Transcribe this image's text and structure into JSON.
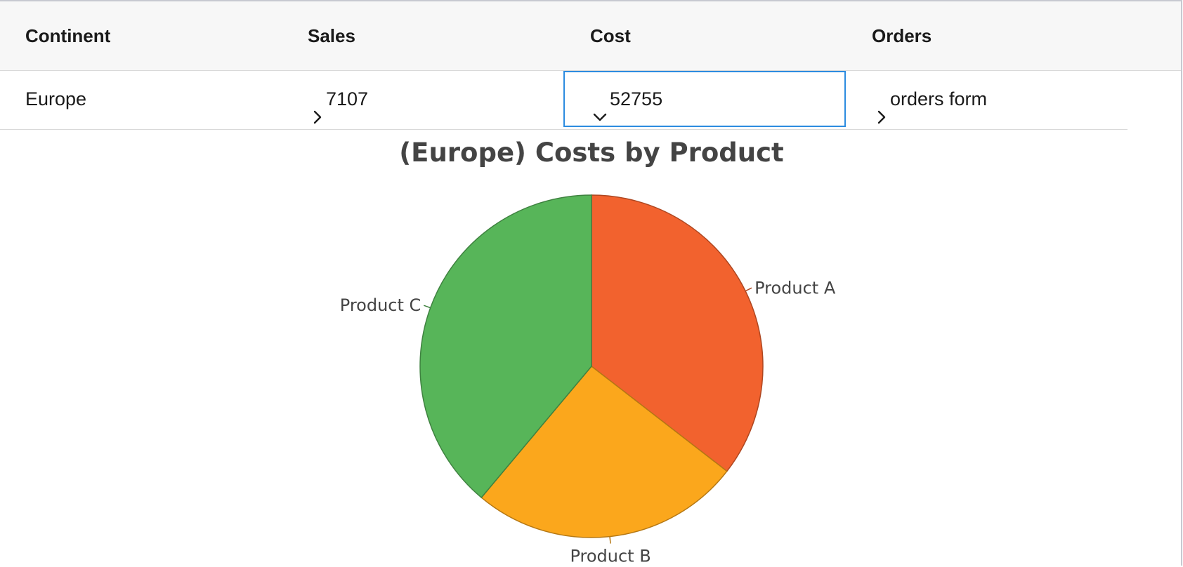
{
  "table": {
    "columns": [
      "Continent",
      "Sales",
      "Cost",
      "Orders"
    ],
    "row": {
      "continent": "Europe",
      "sales": "7107",
      "cost": "52755",
      "orders": "orders form"
    },
    "expanded_column": "Cost"
  },
  "icons": {
    "collapsed": "chevron-right-icon",
    "expanded": "chevron-down-icon"
  },
  "colors": {
    "selection_border": "#2d8ce0",
    "header_bg": "#f7f7f7"
  },
  "chart_data": {
    "type": "pie",
    "title": "(Europe) Costs by Product",
    "slices": [
      {
        "label": "Product A",
        "value": 35.5,
        "color": "#f2622e"
      },
      {
        "label": "Product B",
        "value": 25.6,
        "color": "#fba71c"
      },
      {
        "label": "Product C",
        "value": 38.9,
        "color": "#57b559"
      }
    ],
    "start_angle": "12 o'clock",
    "direction": "clockwise",
    "legend": "none",
    "labels": "outside"
  }
}
